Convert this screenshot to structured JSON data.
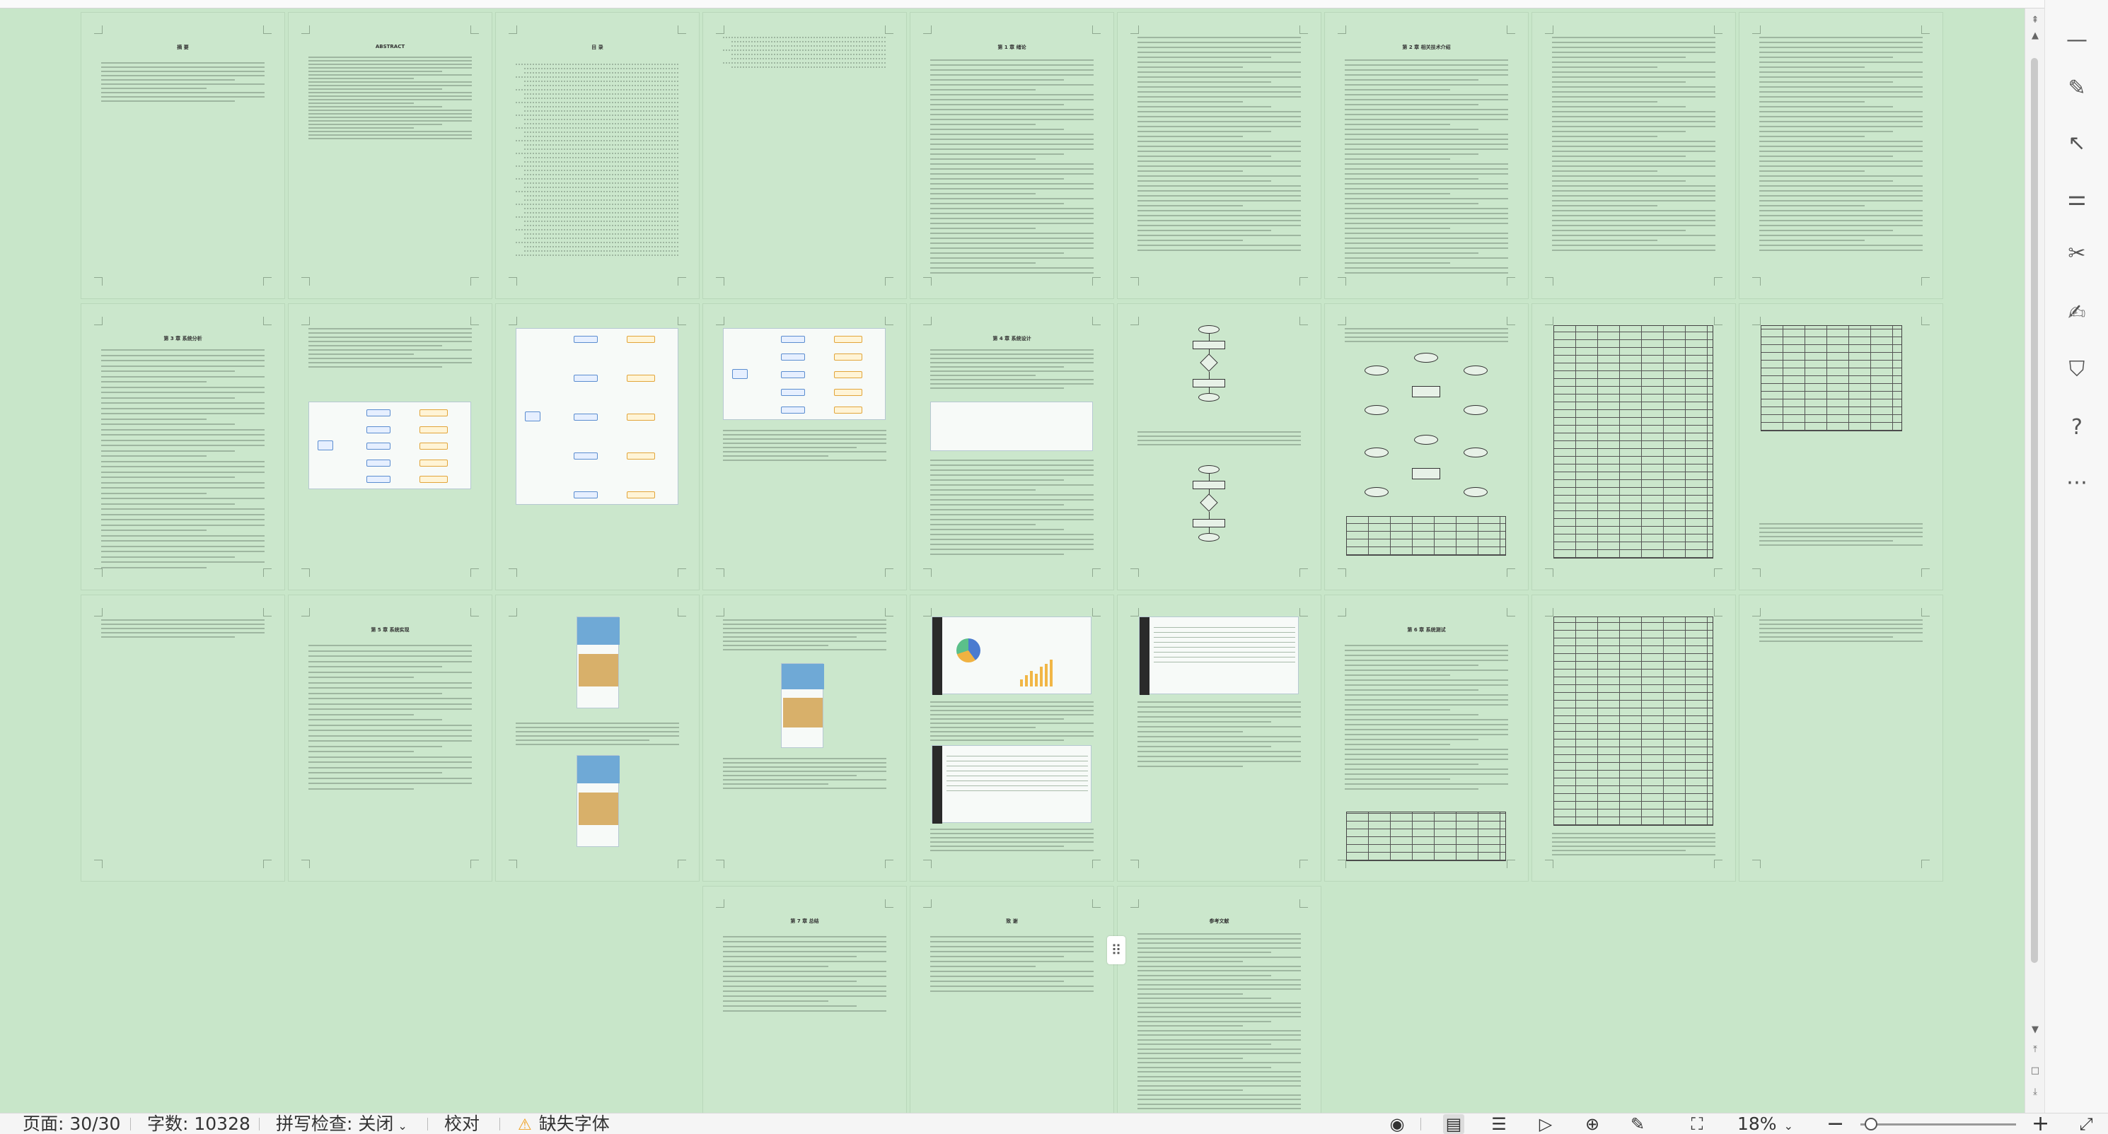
{
  "statusbar": {
    "page_label": "页面: 30/30",
    "word_count_label": "字数: 10328",
    "spellcheck_label": "拼写检查: 关闭",
    "proofread_label": "校对",
    "missing_font_label": "缺失字体",
    "zoom_value": "18%",
    "zoom_minus": "−",
    "zoom_plus": "+",
    "zoom_level": 0.07
  },
  "document": {
    "page_count": 30,
    "pages": [
      {
        "title": "摘 要"
      },
      {
        "title": "ABSTRACT"
      },
      {
        "title": "目 录"
      },
      {
        "title": ""
      },
      {
        "title": "第 1 章 绪论"
      },
      {
        "title": ""
      },
      {
        "title": "第 2 章 相关技术介绍"
      },
      {
        "title": ""
      },
      {
        "title": ""
      },
      {
        "title": "第 3 章 系统分析"
      },
      {
        "title": ""
      },
      {
        "title": ""
      },
      {
        "title": ""
      },
      {
        "title": "第 4 章 系统设计"
      },
      {
        "title": ""
      },
      {
        "title": ""
      },
      {
        "title": ""
      },
      {
        "title": ""
      },
      {
        "title": ""
      },
      {
        "title": "第 5 章 系统实现"
      },
      {
        "title": ""
      },
      {
        "title": ""
      },
      {
        "title": ""
      },
      {
        "title": ""
      },
      {
        "title": "第 6 章 系统测试"
      },
      {
        "title": ""
      },
      {
        "title": ""
      },
      {
        "title": "第 7 章 总结"
      },
      {
        "title": "致 谢"
      },
      {
        "title": "参考文献"
      }
    ]
  },
  "icons": {
    "eye": "eye-icon",
    "page_view": "page-view-icon",
    "outline": "outline-icon",
    "play": "play-icon",
    "web": "globe-icon",
    "pen": "pen-icon",
    "fit": "fit-page-icon",
    "warning": "warning-icon"
  },
  "colors": {
    "canvas_bg": "#c8e6c9",
    "page_bg": "#cbe7cc",
    "warning": "#f0a020"
  }
}
